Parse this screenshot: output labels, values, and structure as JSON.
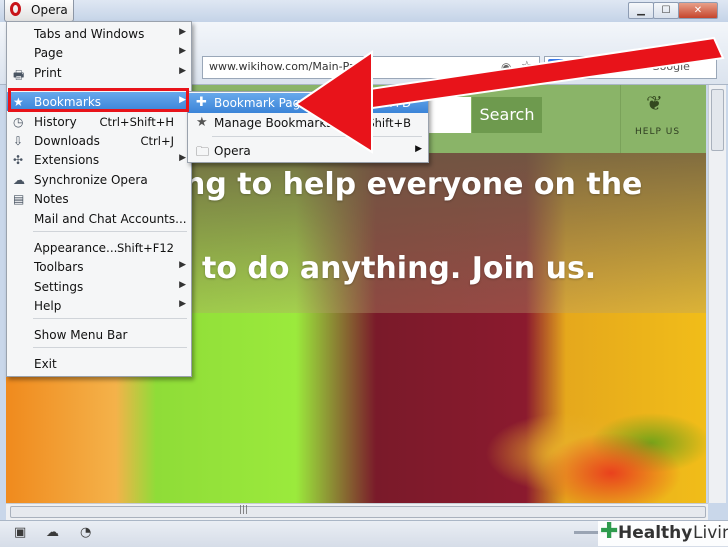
{
  "window": {
    "app_button": "Opera",
    "controls": {
      "minimize": "▁",
      "maximize": "☐",
      "close": "✕"
    }
  },
  "toolbar": {
    "address": "www.wikihow.com/Main-Page",
    "search_placeholder": "Search with Google",
    "search_engine_icon": "g"
  },
  "page": {
    "search_button": "Search",
    "help_label": "HELP US",
    "hero_line1": "ng to help everyone on the",
    "hero_line2": "to do anything. Join us."
  },
  "main_menu": {
    "items": [
      {
        "label": "Tabs and Windows",
        "shortcut": "",
        "submenu": true,
        "icon": ""
      },
      {
        "label": "Page",
        "shortcut": "",
        "submenu": true,
        "icon": ""
      },
      {
        "label": "Print",
        "shortcut": "",
        "submenu": true,
        "icon": "printer-icon"
      },
      {
        "label": "Bookmarks",
        "shortcut": "",
        "submenu": true,
        "icon": "star-icon",
        "active": true
      },
      {
        "label": "History",
        "shortcut": "Ctrl+Shift+H",
        "submenu": false,
        "icon": "clock-icon"
      },
      {
        "label": "Downloads",
        "shortcut": "Ctrl+J",
        "submenu": false,
        "icon": "download-icon"
      },
      {
        "label": "Extensions",
        "shortcut": "",
        "submenu": true,
        "icon": "puzzle-icon"
      },
      {
        "label": "Synchronize Opera",
        "shortcut": "",
        "submenu": false,
        "icon": "cloud-icon"
      },
      {
        "label": "Notes",
        "shortcut": "",
        "submenu": false,
        "icon": "note-icon"
      },
      {
        "label": "Mail and Chat Accounts...",
        "shortcut": "",
        "submenu": false,
        "icon": ""
      },
      {
        "label": "Appearance...",
        "shortcut": "Shift+F12",
        "submenu": false,
        "icon": ""
      },
      {
        "label": "Toolbars",
        "shortcut": "",
        "submenu": true,
        "icon": ""
      },
      {
        "label": "Settings",
        "shortcut": "",
        "submenu": true,
        "icon": ""
      },
      {
        "label": "Help",
        "shortcut": "",
        "submenu": true,
        "icon": ""
      },
      {
        "label": "Show Menu Bar",
        "shortcut": "",
        "submenu": false,
        "icon": ""
      },
      {
        "label": "Exit",
        "shortcut": "",
        "submenu": false,
        "icon": ""
      }
    ]
  },
  "bookmarks_menu": {
    "items": [
      {
        "label": "Bookmark Page...",
        "shortcut": "Ctrl+D",
        "icon": "plus-icon",
        "active": true
      },
      {
        "label": "Manage Bookmarks...",
        "shortcut": "Ctrl+Shift+B",
        "icon": "star-icon"
      },
      {
        "label": "Opera",
        "shortcut": "",
        "icon": "folder-icon",
        "submenu": true
      }
    ]
  },
  "watermark": {
    "brand": "Healthy",
    "brand2": "Living"
  },
  "colors": {
    "menu_highlight": "#3b84d8",
    "annotation_red": "#e8131a",
    "site_green": "#8ab468",
    "search_button": "#6e9a4e"
  }
}
